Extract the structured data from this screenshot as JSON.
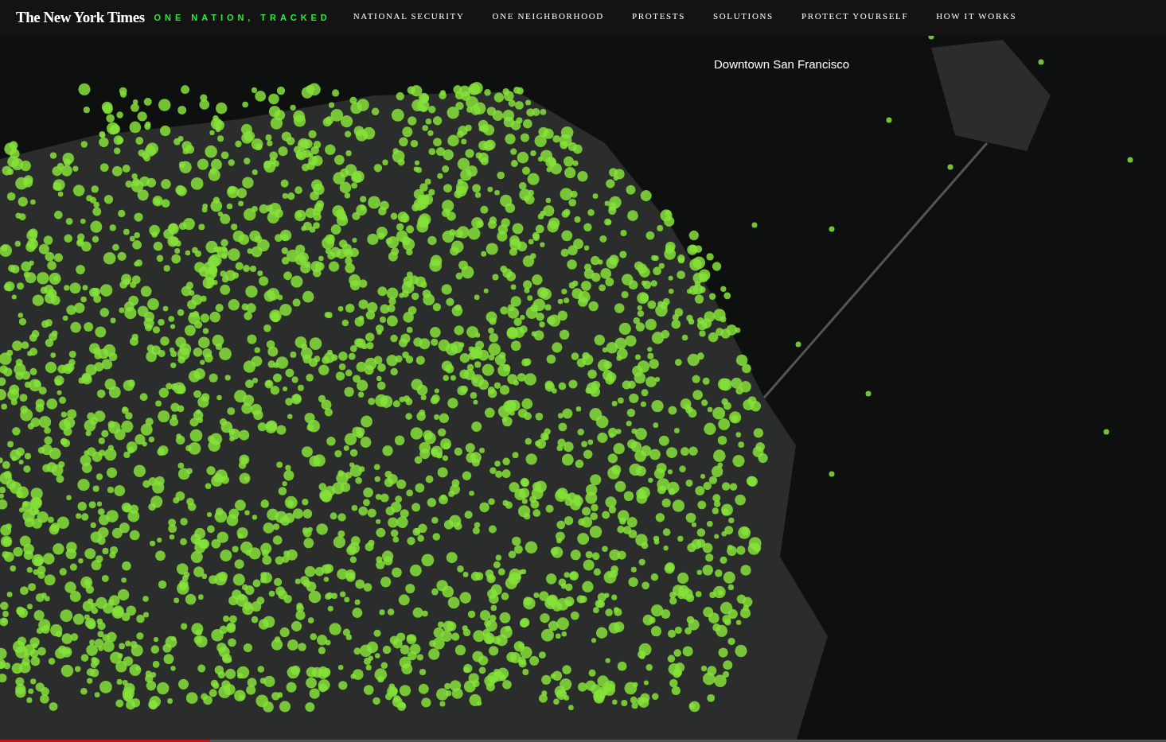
{
  "header": {
    "logo": "The New York Times",
    "series_title": "ONE NATION, TRACKED",
    "nav": [
      {
        "label": "NATIONAL SECURITY",
        "selected": false
      },
      {
        "label": "ONE NEIGHBORHOOD",
        "selected": false
      },
      {
        "label": "PROTESTS",
        "selected": false
      },
      {
        "label": "SOLUTIONS",
        "selected": false
      },
      {
        "label": "PROTECT YOURSELF",
        "selected": false
      },
      {
        "label": "HOW IT WORKS",
        "selected": false
      }
    ]
  },
  "map": {
    "label": "Downtown San Francisco"
  },
  "video_progress": {
    "level": 0.18
  }
}
